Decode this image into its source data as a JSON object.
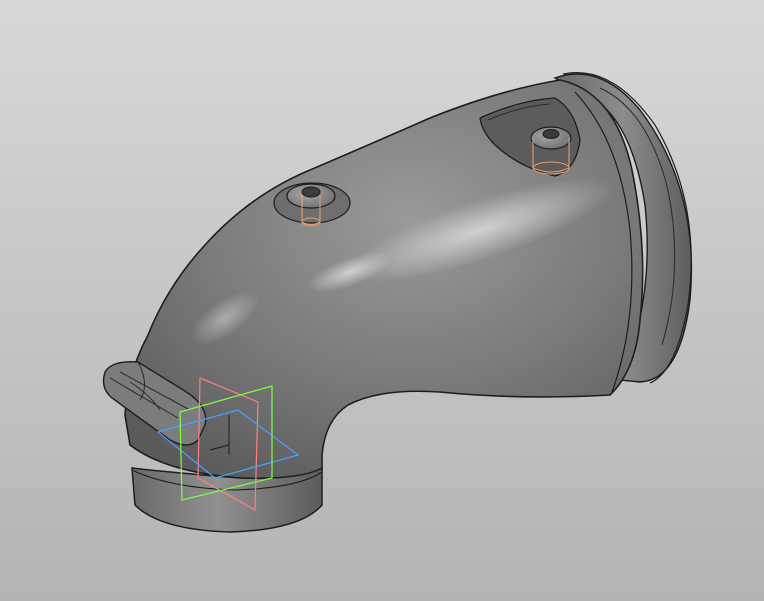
{
  "viewport": {
    "background_top": "#d8d8d8",
    "background_bottom": "#b4b4b4"
  },
  "model": {
    "body_color": "#7a7a7a",
    "edge_color": "#1e1e1e",
    "highlight_color": "#c9c9c9",
    "shadow_color": "#444444",
    "hole_edge_color": "#e0a070"
  },
  "origin_planes": [
    {
      "name": "front",
      "color": "#ff8080"
    },
    {
      "name": "top",
      "color": "#4aa0ff"
    },
    {
      "name": "right",
      "color": "#80ff40"
    }
  ]
}
